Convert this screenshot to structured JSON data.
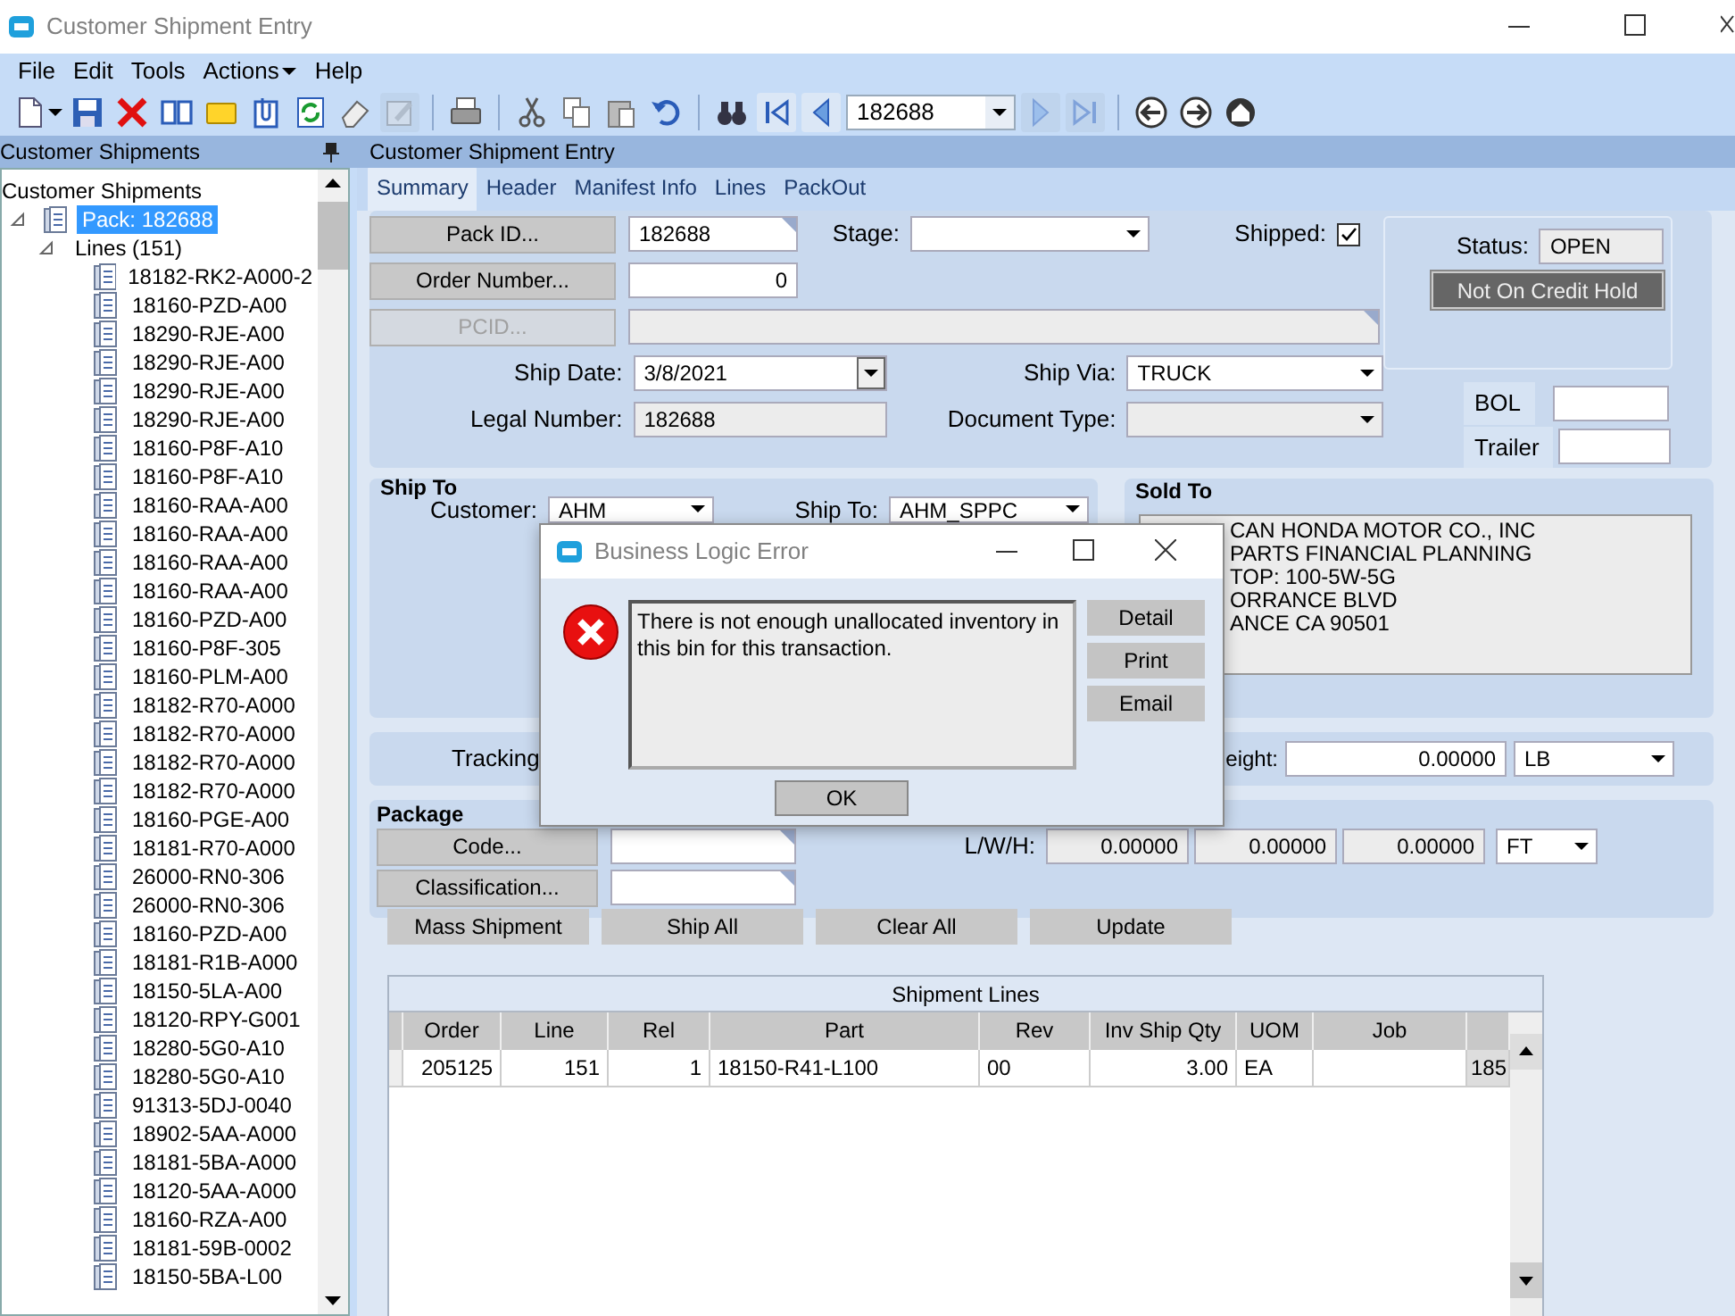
{
  "window": {
    "title": "Customer Shipment Entry"
  },
  "menu": [
    {
      "label": "File"
    },
    {
      "label": "Edit"
    },
    {
      "label": "Tools"
    },
    {
      "label": "Actions",
      "has_submenu": true
    },
    {
      "label": "Help"
    }
  ],
  "toolbar": [
    {
      "kind": "new",
      "disabled": false
    },
    {
      "kind": "save",
      "disabled": false
    },
    {
      "kind": "delete",
      "disabled": false
    },
    {
      "kind": "book",
      "disabled": false
    },
    {
      "kind": "note",
      "disabled": false
    },
    {
      "kind": "attach",
      "disabled": false
    },
    {
      "kind": "refresh",
      "disabled": false
    },
    {
      "kind": "eraser",
      "disabled": false
    },
    {
      "kind": "edit",
      "disabled": true
    },
    {
      "kind": "separator"
    },
    {
      "kind": "print",
      "disabled": false
    },
    {
      "kind": "separator"
    },
    {
      "kind": "cut",
      "disabled": false
    },
    {
      "kind": "copy",
      "disabled": false
    },
    {
      "kind": "paste",
      "disabled": false
    },
    {
      "kind": "undo",
      "disabled": false
    },
    {
      "kind": "separator"
    },
    {
      "kind": "find",
      "disabled": false
    },
    {
      "kind": "first",
      "disabled": false
    },
    {
      "kind": "previous",
      "disabled": false
    },
    {
      "kind": "record",
      "value": "182688"
    },
    {
      "kind": "next",
      "disabled": true
    },
    {
      "kind": "last",
      "disabled": true
    },
    {
      "kind": "separator"
    },
    {
      "kind": "back",
      "disabled": false
    },
    {
      "kind": "forward",
      "disabled": false
    },
    {
      "kind": "home",
      "disabled": false
    }
  ],
  "tree_panel": {
    "title": "Customer Shipments",
    "tree": [
      {
        "label": "Customer Shipments",
        "kind": "root",
        "selected": false,
        "children": [
          {
            "label": "Pack: 182688",
            "kind": "pack",
            "expanded": true,
            "selected": true,
            "children": [
              {
                "label": "Lines (151)",
                "kind": "group",
                "expanded": true,
                "selected": false,
                "children": [
                  {
                    "label": "18182-RK2-A000-2",
                    "kind": "line",
                    "selected": false
                  },
                  {
                    "label": "18160-PZD-A00",
                    "kind": "line",
                    "selected": false
                  },
                  {
                    "label": "18290-RJE-A00",
                    "kind": "line",
                    "selected": false
                  },
                  {
                    "label": "18290-RJE-A00",
                    "kind": "line",
                    "selected": false
                  },
                  {
                    "label": "18290-RJE-A00",
                    "kind": "line",
                    "selected": false
                  },
                  {
                    "label": "18290-RJE-A00",
                    "kind": "line",
                    "selected": false
                  },
                  {
                    "label": "18160-P8F-A10",
                    "kind": "line",
                    "selected": false
                  },
                  {
                    "label": "18160-P8F-A10",
                    "kind": "line",
                    "selected": false
                  },
                  {
                    "label": "18160-RAA-A00",
                    "kind": "line",
                    "selected": false
                  },
                  {
                    "label": "18160-RAA-A00",
                    "kind": "line",
                    "selected": false
                  },
                  {
                    "label": "18160-RAA-A00",
                    "kind": "line",
                    "selected": false
                  },
                  {
                    "label": "18160-RAA-A00",
                    "kind": "line",
                    "selected": false
                  },
                  {
                    "label": "18160-PZD-A00",
                    "kind": "line",
                    "selected": false
                  },
                  {
                    "label": "18160-P8F-305",
                    "kind": "line",
                    "selected": false
                  },
                  {
                    "label": "18160-PLM-A00",
                    "kind": "line",
                    "selected": false
                  },
                  {
                    "label": "18182-R70-A000",
                    "kind": "line",
                    "selected": false
                  },
                  {
                    "label": "18182-R70-A000",
                    "kind": "line",
                    "selected": false
                  },
                  {
                    "label": "18182-R70-A000",
                    "kind": "line",
                    "selected": false
                  },
                  {
                    "label": "18182-R70-A000",
                    "kind": "line",
                    "selected": false
                  },
                  {
                    "label": "18160-PGE-A00",
                    "kind": "line",
                    "selected": false
                  },
                  {
                    "label": "18181-R70-A000",
                    "kind": "line",
                    "selected": false
                  },
                  {
                    "label": "26000-RN0-306",
                    "kind": "line",
                    "selected": false
                  },
                  {
                    "label": "26000-RN0-306",
                    "kind": "line",
                    "selected": false
                  },
                  {
                    "label": "18160-PZD-A00",
                    "kind": "line",
                    "selected": false
                  },
                  {
                    "label": "18181-R1B-A000",
                    "kind": "line",
                    "selected": false
                  },
                  {
                    "label": "18150-5LA-A00",
                    "kind": "line",
                    "selected": false
                  },
                  {
                    "label": "18120-RPY-G001",
                    "kind": "line",
                    "selected": false
                  },
                  {
                    "label": "18280-5G0-A10",
                    "kind": "line",
                    "selected": false
                  },
                  {
                    "label": "18280-5G0-A10",
                    "kind": "line",
                    "selected": false
                  },
                  {
                    "label": "91313-5DJ-0040",
                    "kind": "line",
                    "selected": false
                  },
                  {
                    "label": "18902-5AA-A000",
                    "kind": "line",
                    "selected": false
                  },
                  {
                    "label": "18181-5BA-A000",
                    "kind": "line",
                    "selected": false
                  },
                  {
                    "label": "18120-5AA-A000",
                    "kind": "line",
                    "selected": false
                  },
                  {
                    "label": "18160-RZA-A00",
                    "kind": "line",
                    "selected": false
                  },
                  {
                    "label": "18181-59B-0002",
                    "kind": "line",
                    "selected": false
                  },
                  {
                    "label": "18150-5BA-L00",
                    "kind": "line",
                    "selected": false
                  }
                ]
              }
            ]
          }
        ]
      }
    ]
  },
  "entry_panel": {
    "title": "Customer Shipment Entry"
  },
  "tabs": [
    {
      "label": "Summary",
      "selected": true
    },
    {
      "label": "Header",
      "selected": false
    },
    {
      "label": "Manifest Info",
      "selected": false
    },
    {
      "label": "Lines",
      "selected": false
    },
    {
      "label": "PackOut",
      "selected": false
    }
  ],
  "summary": {
    "pack_id": {
      "button": "Pack ID...",
      "value": "182688"
    },
    "stage": {
      "label": "Stage:"
    },
    "shipped": {
      "label": "Shipped:",
      "checked": true
    },
    "order_number": {
      "button": "Order Number...",
      "value": "0"
    },
    "pcid": {
      "button": "PCID...",
      "disabled": true
    },
    "ship_date": {
      "label": "Ship Date:",
      "value": "3/8/2021"
    },
    "ship_via": {
      "label": "Ship Via:",
      "value": "TRUCK"
    },
    "legal_number": {
      "label": "Legal Number:",
      "value": "182688"
    },
    "document_type": {
      "label": "Document Type:",
      "disabled": true
    },
    "status": {
      "label": "Status:",
      "value": "OPEN"
    },
    "credit_hold": "Not On Credit Hold",
    "bol": {
      "label": "BOL"
    },
    "trailer": {
      "label": "Trailer"
    }
  },
  "ship_to": {
    "title": "Ship To",
    "customer_label": "Customer:",
    "customer": "AHM",
    "ship_to_label": "Ship To:",
    "ship_to": "AHM_SPPC"
  },
  "sold_to": {
    "title": "Sold To",
    "address": [
      "CAN HONDA MOTOR CO., INC",
      "PARTS FINANCIAL PLANNING",
      "TOP:  100-5W-5G",
      "ORRANCE BLVD",
      "ANCE CA 90501"
    ]
  },
  "tracking": {
    "label": "Tracking",
    "weight_label": "eight:",
    "weight": "0.00000",
    "weight_unit": "LB"
  },
  "package": {
    "title": "Package",
    "code_button": "Code...",
    "classification_button": "Classification...",
    "lwh_label": "L/W/H:",
    "lwh": [
      "0.00000",
      "0.00000",
      "0.00000"
    ],
    "unit": "FT"
  },
  "actions": [
    "Mass Shipment",
    "Ship All",
    "Clear All",
    "Update"
  ],
  "grid": {
    "title": "Shipment Lines",
    "columns": [
      "Order",
      "Line",
      "Rel",
      "Part",
      "Rev",
      "Inv Ship Qty",
      "UOM",
      "Job"
    ],
    "rows": [
      [
        "205125",
        "151",
        "1",
        "18150-R41-L100",
        "00",
        "3.00",
        "EA",
        null,
        "185"
      ]
    ]
  },
  "dialog": {
    "title": "Business Logic Error",
    "message": "There is not enough unallocated inventory in this bin for this transaction.",
    "buttons": [
      "Detail",
      "Print",
      "Email"
    ],
    "ok": "OK"
  }
}
